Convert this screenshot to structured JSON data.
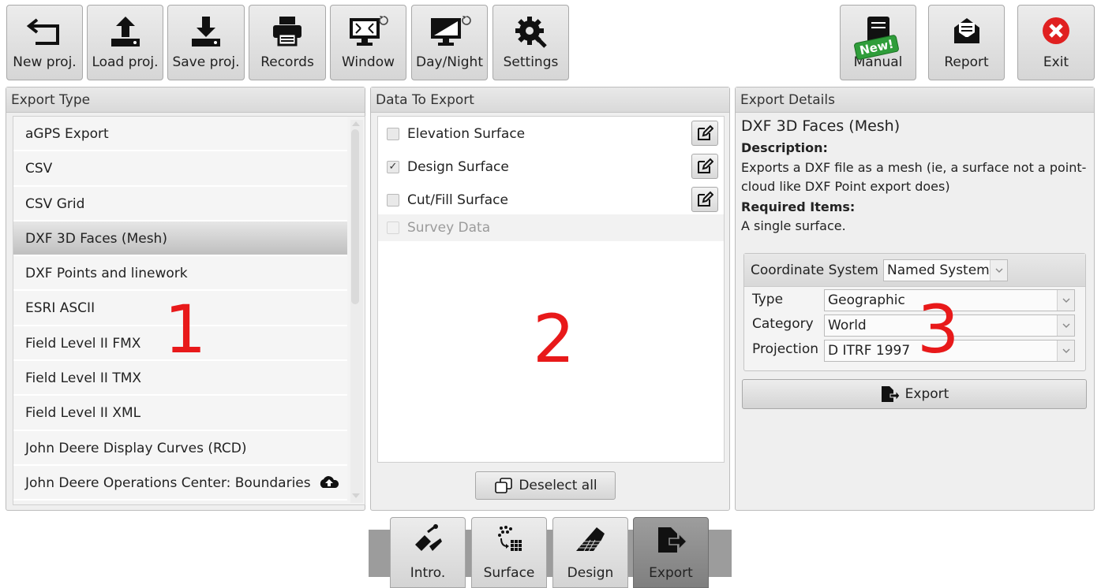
{
  "toolbar": {
    "new_proj": "New proj.",
    "load_proj": "Load proj.",
    "save_proj": "Save proj.",
    "records": "Records",
    "window": "Window",
    "day_night": "Day/Night",
    "settings": "Settings",
    "manual": "Manual",
    "manual_badge": "New!",
    "report": "Report",
    "exit": "Exit"
  },
  "export_type": {
    "title": "Export Type",
    "items": [
      "aGPS Export",
      "CSV",
      "CSV Grid",
      "DXF 3D Faces (Mesh)",
      "DXF Points and linework",
      "ESRI ASCII",
      "Field Level II FMX",
      "Field Level II TMX",
      "Field Level II XML",
      "John Deere Display Curves (RCD)",
      "John Deere Operations Center: Boundaries"
    ],
    "selected_index": 3
  },
  "data_to_export": {
    "title": "Data To Export",
    "rows": [
      {
        "label": "Elevation Surface",
        "checked": false,
        "enabled": true
      },
      {
        "label": "Design Surface",
        "checked": true,
        "enabled": true
      },
      {
        "label": "Cut/Fill Surface",
        "checked": false,
        "enabled": true
      },
      {
        "label": "Survey Data",
        "checked": false,
        "enabled": false
      }
    ],
    "deselect_all": "Deselect all"
  },
  "export_details": {
    "title": "Export Details",
    "name": "DXF 3D Faces (Mesh)",
    "description_label": "Description:",
    "description": "Exports a DXF file as a mesh (ie, a surface not a point-cloud like DXF Point export does)",
    "required_label": "Required Items:",
    "required": "A single surface.",
    "coordinate_system_label": "Coordinate System",
    "coordinate_system_value": "Named System",
    "type_label": "Type",
    "type_value": "Geographic",
    "category_label": "Category",
    "category_value": "World",
    "projection_label": "Projection",
    "projection_value": "D ITRF 1997",
    "export_button": "Export"
  },
  "annotations": {
    "one": "1",
    "two": "2",
    "three": "3"
  },
  "bottom_nav": {
    "intro": "Intro.",
    "surface": "Surface",
    "design": "Design",
    "export": "Export",
    "active": "Export"
  },
  "colors": {
    "annotation": "#e8191a",
    "exit_red": "#e02020",
    "badge_green": "#2f9d3a"
  }
}
